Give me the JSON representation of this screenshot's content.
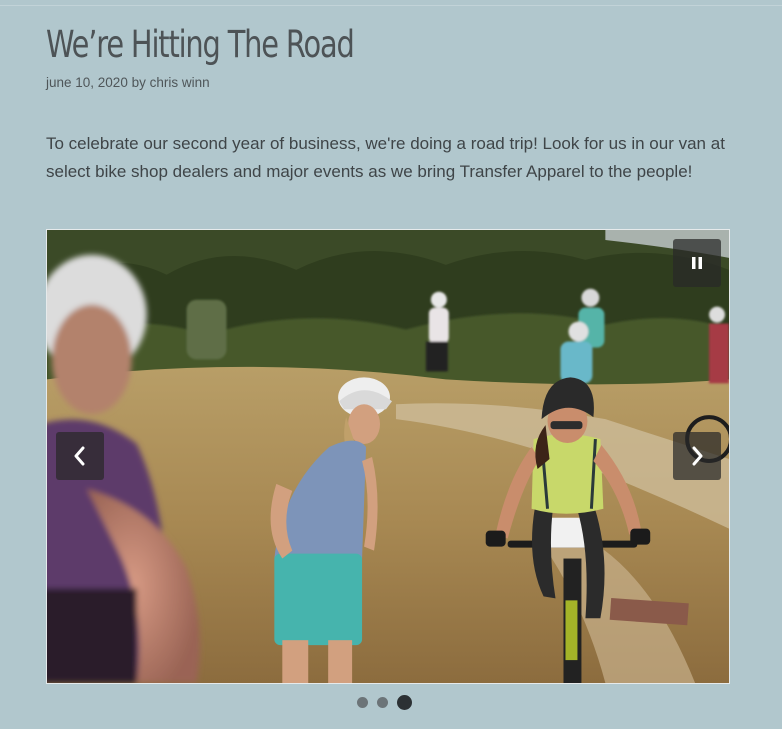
{
  "post": {
    "title": "We’re Hitting The Road",
    "date": "june 10, 2020",
    "byline": "by chris winn",
    "intro": "To celebrate our second year of business, we're doing a road trip! Look for us in our van at select bike shop dealers and major events as we bring Transfer Apparel to the people!"
  },
  "slider": {
    "slide_count": 3,
    "active_slide": 3,
    "controls": {
      "pause_icon": "pause-icon",
      "prev_icon": "chevron-left-icon",
      "next_icon": "chevron-right-icon"
    }
  },
  "colors": {
    "page_background": "#b1c7cd",
    "text": "#3f4548",
    "control_background": "#282828",
    "dot_inactive": "#6c7478",
    "dot_active": "#2c3134"
  }
}
